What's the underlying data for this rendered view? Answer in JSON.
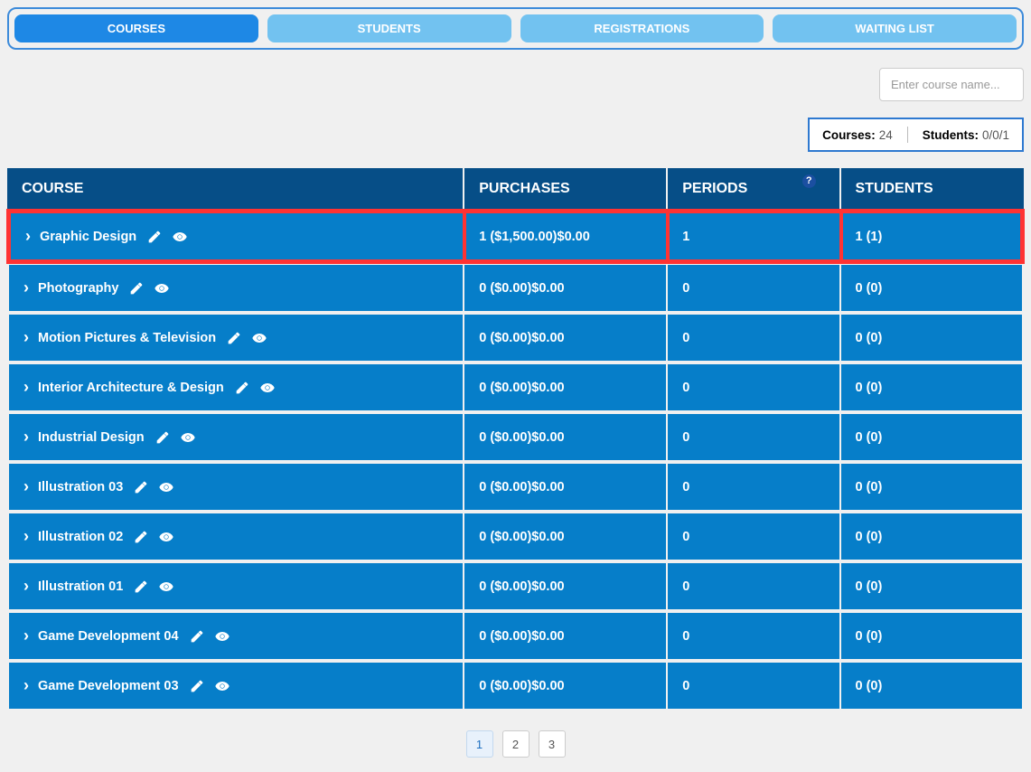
{
  "tabs": [
    {
      "label": "COURSES",
      "active": true
    },
    {
      "label": "STUDENTS",
      "active": false
    },
    {
      "label": "REGISTRATIONS",
      "active": false
    },
    {
      "label": "WAITING LIST",
      "active": false
    }
  ],
  "search": {
    "placeholder": "Enter course name..."
  },
  "stats": {
    "courses_label": "Courses:",
    "courses_value": "24",
    "students_label": "Students:",
    "students_value": "0/0/1"
  },
  "columns": {
    "course": "COURSE",
    "purchases": "PURCHASES",
    "periods": "PERIODS",
    "students": "STUDENTS",
    "help": "?"
  },
  "rows": [
    {
      "course": "Graphic Design",
      "purchases": "1 ($1,500.00)$0.00",
      "periods": "1",
      "students": "1 (1)",
      "highlighted": true
    },
    {
      "course": "Photography",
      "purchases": "0 ($0.00)$0.00",
      "periods": "0",
      "students": "0 (0)",
      "highlighted": false
    },
    {
      "course": "Motion Pictures & Television",
      "purchases": "0 ($0.00)$0.00",
      "periods": "0",
      "students": "0 (0)",
      "highlighted": false
    },
    {
      "course": "Interior Architecture & Design",
      "purchases": "0 ($0.00)$0.00",
      "periods": "0",
      "students": "0 (0)",
      "highlighted": false
    },
    {
      "course": "Industrial Design",
      "purchases": "0 ($0.00)$0.00",
      "periods": "0",
      "students": "0 (0)",
      "highlighted": false
    },
    {
      "course": "Illustration 03",
      "purchases": "0 ($0.00)$0.00",
      "periods": "0",
      "students": "0 (0)",
      "highlighted": false
    },
    {
      "course": "Illustration 02",
      "purchases": "0 ($0.00)$0.00",
      "periods": "0",
      "students": "0 (0)",
      "highlighted": false
    },
    {
      "course": "Illustration 01",
      "purchases": "0 ($0.00)$0.00",
      "periods": "0",
      "students": "0 (0)",
      "highlighted": false
    },
    {
      "course": "Game Development 04",
      "purchases": "0 ($0.00)$0.00",
      "periods": "0",
      "students": "0 (0)",
      "highlighted": false
    },
    {
      "course": "Game Development 03",
      "purchases": "0 ($0.00)$0.00",
      "periods": "0",
      "students": "0 (0)",
      "highlighted": false
    }
  ],
  "pagination": [
    "1",
    "2",
    "3"
  ],
  "icons": {
    "edit": "edit-icon",
    "view": "eye-icon"
  }
}
